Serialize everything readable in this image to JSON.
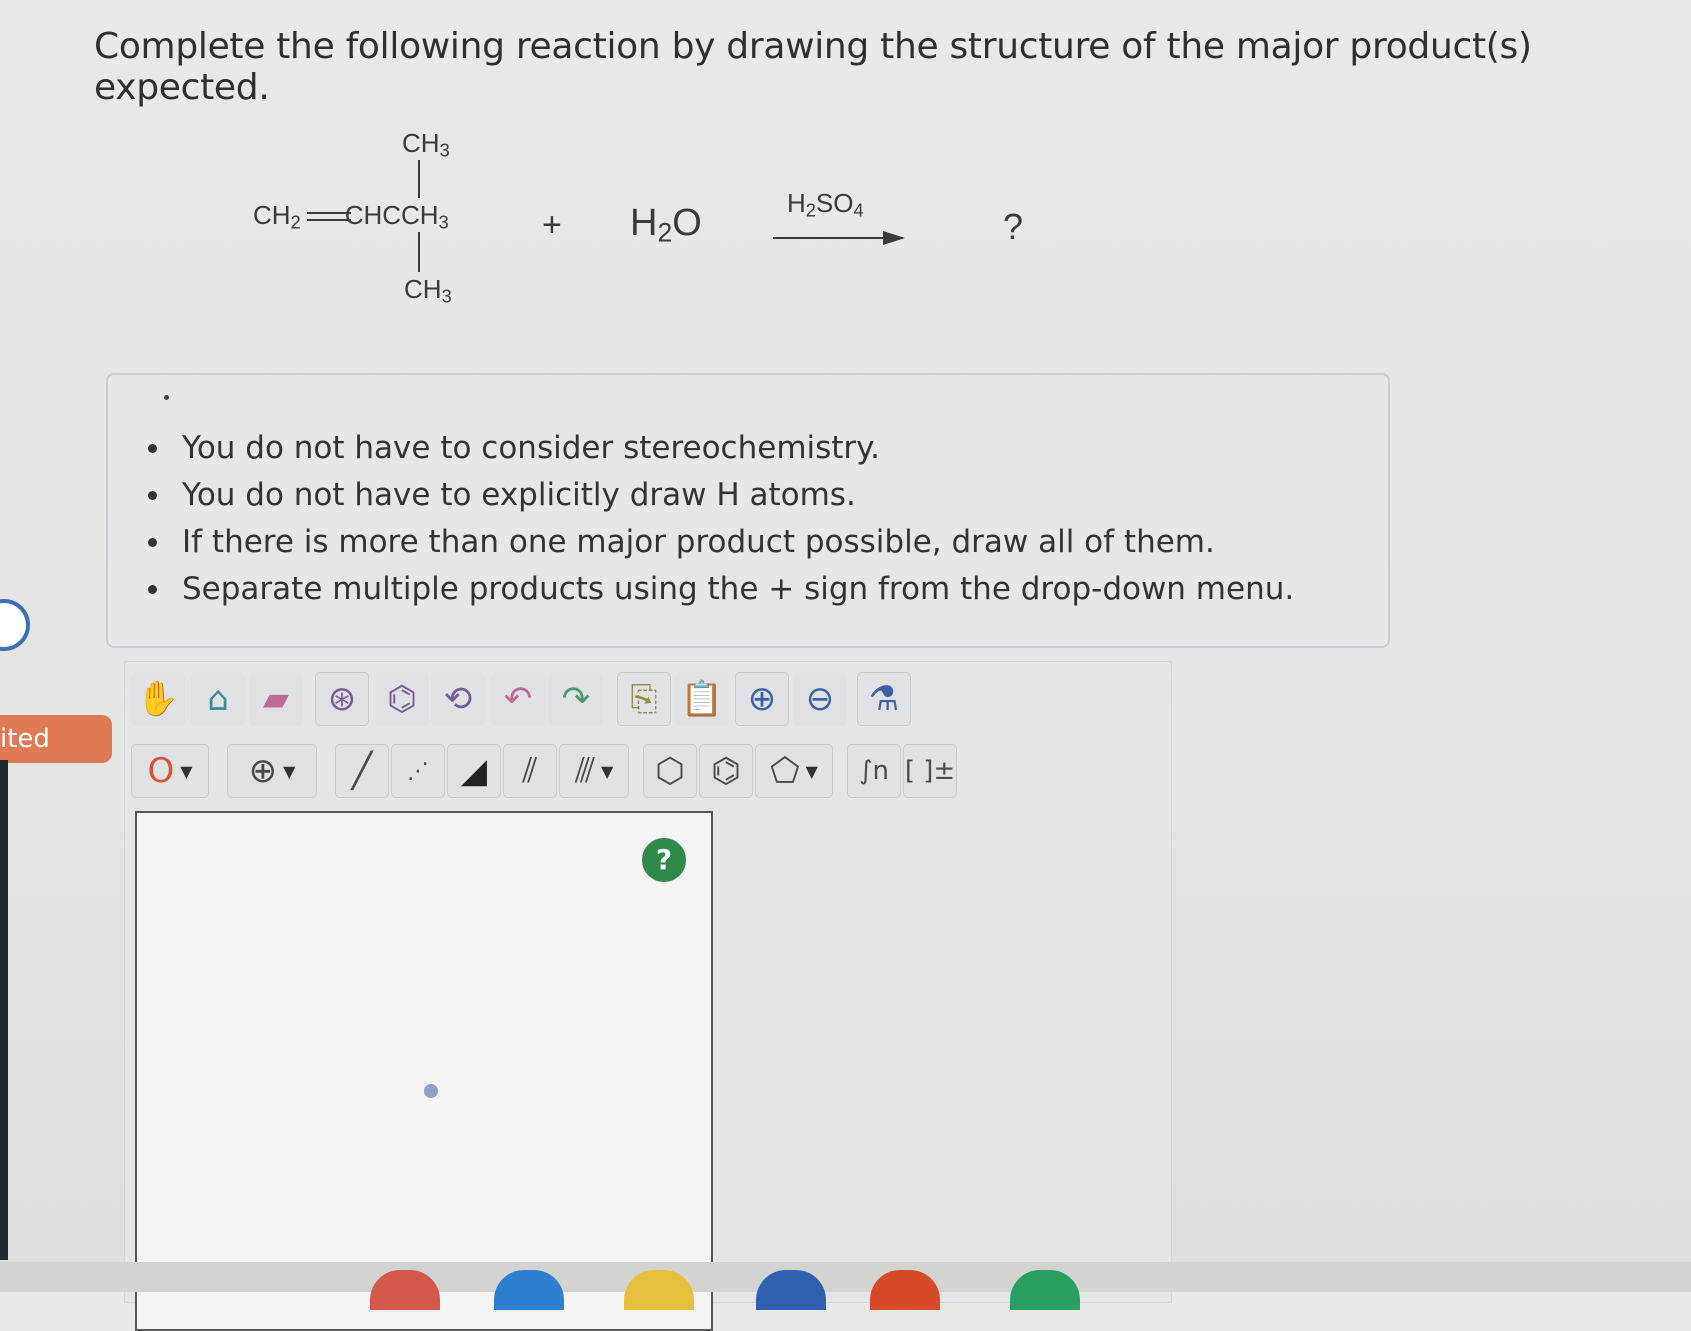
{
  "question": "Complete the following reaction by drawing the structure of the major product(s) expected.",
  "reaction": {
    "top_substituent": "CH3",
    "main_chain": "CH2=CHCCH3",
    "bottom_substituent": "CH3",
    "plus": "+",
    "reagent": "H2O",
    "catalyst": "H2SO4",
    "product": "?"
  },
  "instructions": [
    "You do not have to consider stereochemistry.",
    "You do not have to explicitly draw H atoms.",
    "If there is more than one major product possible, draw all of them.",
    "Separate multiple products using the + sign from the drop-down menu."
  ],
  "side_tab_label": "ited",
  "toolbar": {
    "atom_selector_value": "O",
    "charge_selector_value": "⊕",
    "help_label": "?",
    "bracket_label": "[ ]±"
  },
  "colors": {
    "side_tab": "#e07a55",
    "help_button": "#2f8a4a",
    "canvas_border": "#555555"
  }
}
